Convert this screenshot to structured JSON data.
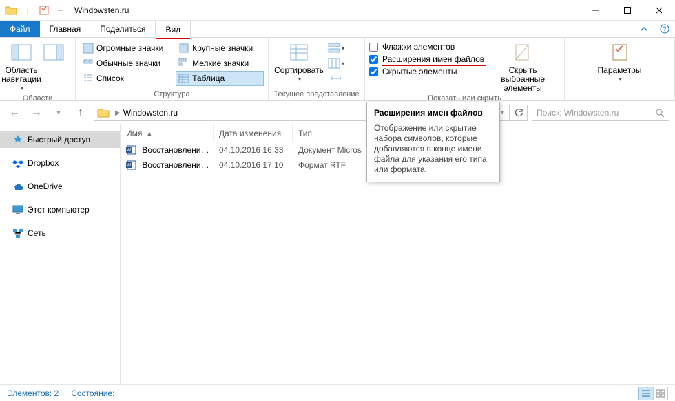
{
  "window": {
    "title": "Windowsten.ru"
  },
  "tabs": {
    "file": "Файл",
    "home": "Главная",
    "share": "Поделиться",
    "view": "Вид"
  },
  "ribbon": {
    "panes": {
      "nav": "Область навигации",
      "group": "Области"
    },
    "layout": {
      "huge": "Огромные значки",
      "large": "Крупные значки",
      "normal": "Обычные значки",
      "small": "Мелкие значки",
      "list": "Список",
      "table": "Таблица",
      "group": "Структура"
    },
    "sort": {
      "btn": "Сортировать",
      "group": "Текущее представление"
    },
    "show": {
      "checkboxes": "Флажки элементов",
      "extensions": "Расширения имен файлов",
      "hidden": "Скрытые элементы",
      "hide_selected_l1": "Скрыть выбранные",
      "hide_selected_l2": "элементы",
      "group": "Показать или скрыть"
    },
    "options": {
      "btn": "Параметры"
    }
  },
  "address": {
    "folder": "Windowsten.ru",
    "search_placeholder": "Поиск: Windowsten.ru"
  },
  "sidebar": {
    "quick": "Быстрый доступ",
    "dropbox": "Dropbox",
    "onedrive": "OneDrive",
    "thispc": "Этот компьютер",
    "network": "Сеть"
  },
  "columns": {
    "name": "Имя",
    "date": "Дата изменения",
    "type": "Тип"
  },
  "files": [
    {
      "name": "Восстановление ...",
      "date": "04.10.2016 16:33",
      "type": "Документ Micros"
    },
    {
      "name": "Восстановление ...",
      "date": "04.10.2016 17:10",
      "type": "Формат RTF"
    }
  ],
  "tooltip": {
    "title": "Расширения имен файлов",
    "body": "Отображение или скрытие набора символов, которые добавляются в конце имени файла для указания его типа или формата."
  },
  "status": {
    "count_label": "Элементов: 2",
    "state_label": "Состояние:"
  }
}
